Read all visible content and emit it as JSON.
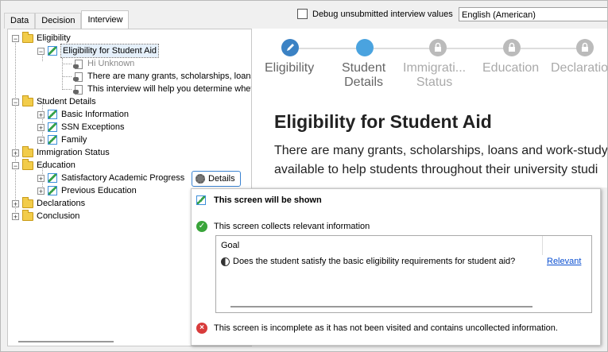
{
  "tabs": [
    "Data",
    "Decision",
    "Interview"
  ],
  "active_tab": "Interview",
  "debug_label": "Debug unsubmitted interview values",
  "language": "English (American)",
  "tree": {
    "eligibility": "Eligibility",
    "eligibility_screen": "Eligibility for Student Aid",
    "hi_unknown": "Hi Unknown",
    "grants_line": "There are many grants, scholarships, loans",
    "interview_help": "This interview will help you determine whet",
    "student_details": "Student Details",
    "basic_info": "Basic Information",
    "ssn": "SSN Exceptions",
    "family": "Family",
    "immigration": "Immigration Status",
    "education": "Education",
    "sat_progress": "Satisfactory Academic Progress",
    "prev_education": "Previous Education",
    "declarations": "Declarations",
    "conclusion": "Conclusion"
  },
  "details_button": "Details",
  "stepper": {
    "steps": [
      "Eligibility",
      "Student\nDetails",
      "Immigrati...\nStatus",
      "Education",
      "Declaratio"
    ],
    "step1": "Eligibility",
    "step2a": "Student",
    "step2b": "Details",
    "step3a": "Immigrati...",
    "step3b": "Status",
    "step4": "Education",
    "step5": "Declaratio",
    "colors": {
      "active": "#3b82c4",
      "current": "#4aa3df",
      "locked": "#bbbbbb"
    }
  },
  "page": {
    "heading": "Eligibility for Student Aid",
    "para1": "There are many grants, scholarships, loans and work-study",
    "para2": "available to help students throughout their university studi"
  },
  "popup": {
    "title": "This screen will be shown",
    "collects": "This screen collects relevant information",
    "goal_header": "Goal",
    "goal_question": "Does the student satisfy the basic eligibility requirements for student aid?",
    "relevant": "Relevant",
    "incomplete": "This screen is incomplete as it has not been visited and contains uncollected information."
  }
}
